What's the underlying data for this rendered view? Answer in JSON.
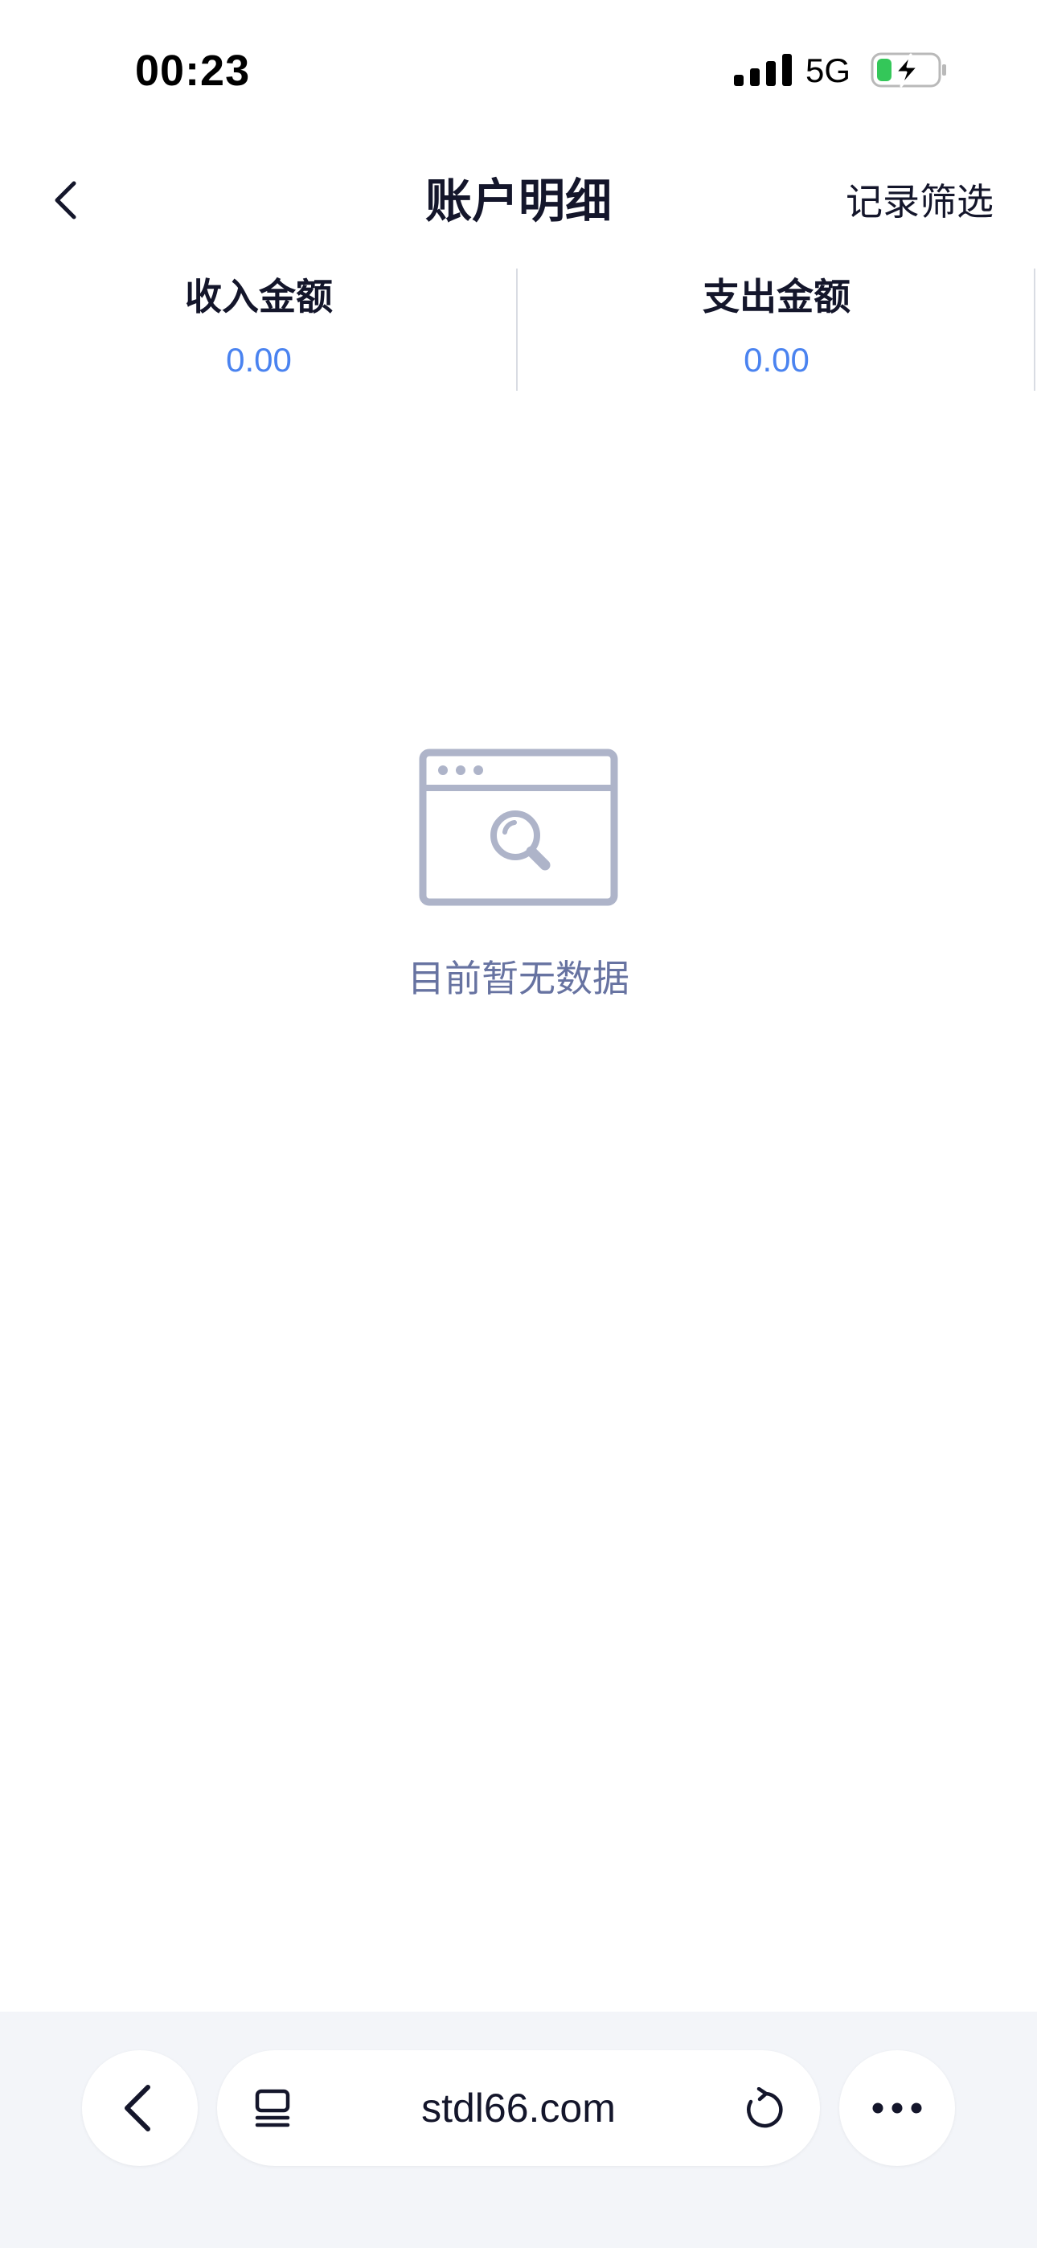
{
  "status_bar": {
    "time": "00:23",
    "network": "5G",
    "signal_icon": "cellular-signal-icon",
    "battery_icon": "battery-charging-icon",
    "battery_color": "#34c759"
  },
  "nav": {
    "title": "账户明细",
    "filter_label": "记录筛选",
    "back_icon": "chevron-left-icon"
  },
  "summary": {
    "income_label": "收入金额",
    "income_value": "0.00",
    "expense_label": "支出金额",
    "expense_value": "0.00",
    "value_color": "#4a83f0"
  },
  "empty_state": {
    "icon": "browser-window-search-icon",
    "message": "目前暂无数据",
    "color": "#6773a1"
  },
  "browser_bar": {
    "back_icon": "chevron-left-icon",
    "tabs_icon": "tabs-icon",
    "url": "stdl66.com",
    "reload_icon": "reload-icon",
    "more_icon": "more-horizontal-icon"
  }
}
